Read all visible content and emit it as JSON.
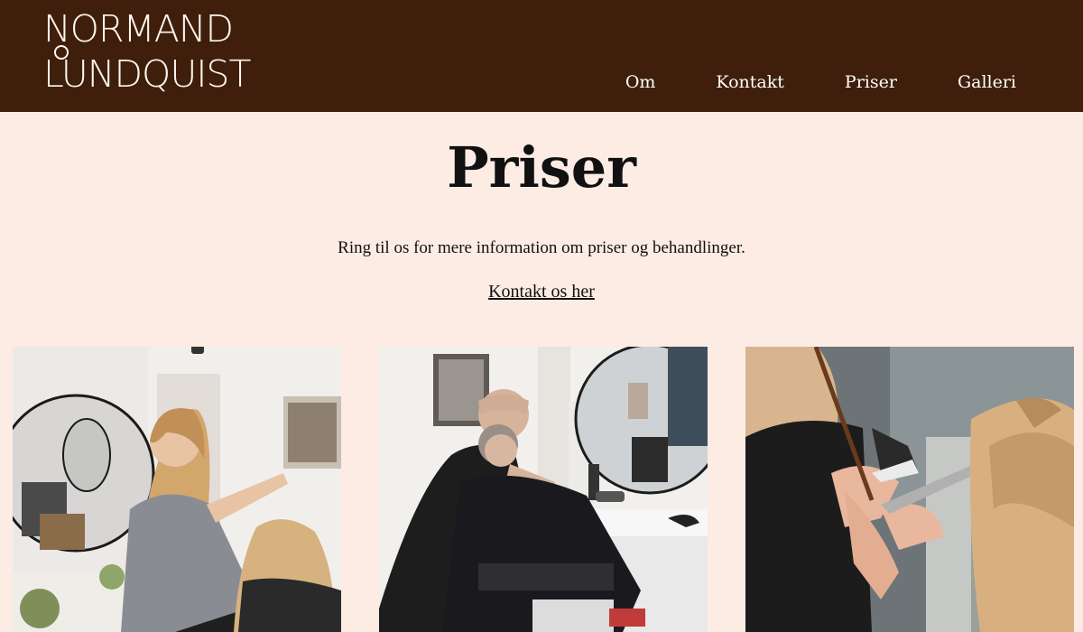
{
  "header": {
    "logo": {
      "line1": "NORMAND",
      "line2": "LUNDQUIST"
    },
    "nav": [
      {
        "label": "Om"
      },
      {
        "label": "Kontakt"
      },
      {
        "label": "Priser"
      },
      {
        "label": "Galleri"
      }
    ]
  },
  "main": {
    "title": "Priser",
    "intro": "Ring til os for mere information om priser og behandlinger.",
    "contact_link": "Kontakt os her"
  },
  "gallery": {
    "photos": [
      {
        "icon": "salon-photo-stylist-blonde"
      },
      {
        "icon": "salon-photo-stylist-client"
      },
      {
        "icon": "salon-photo-hair-closeup"
      }
    ]
  },
  "colors": {
    "header_bg": "#3f1f0b",
    "page_bg": "#fdece4",
    "text": "#111111"
  }
}
